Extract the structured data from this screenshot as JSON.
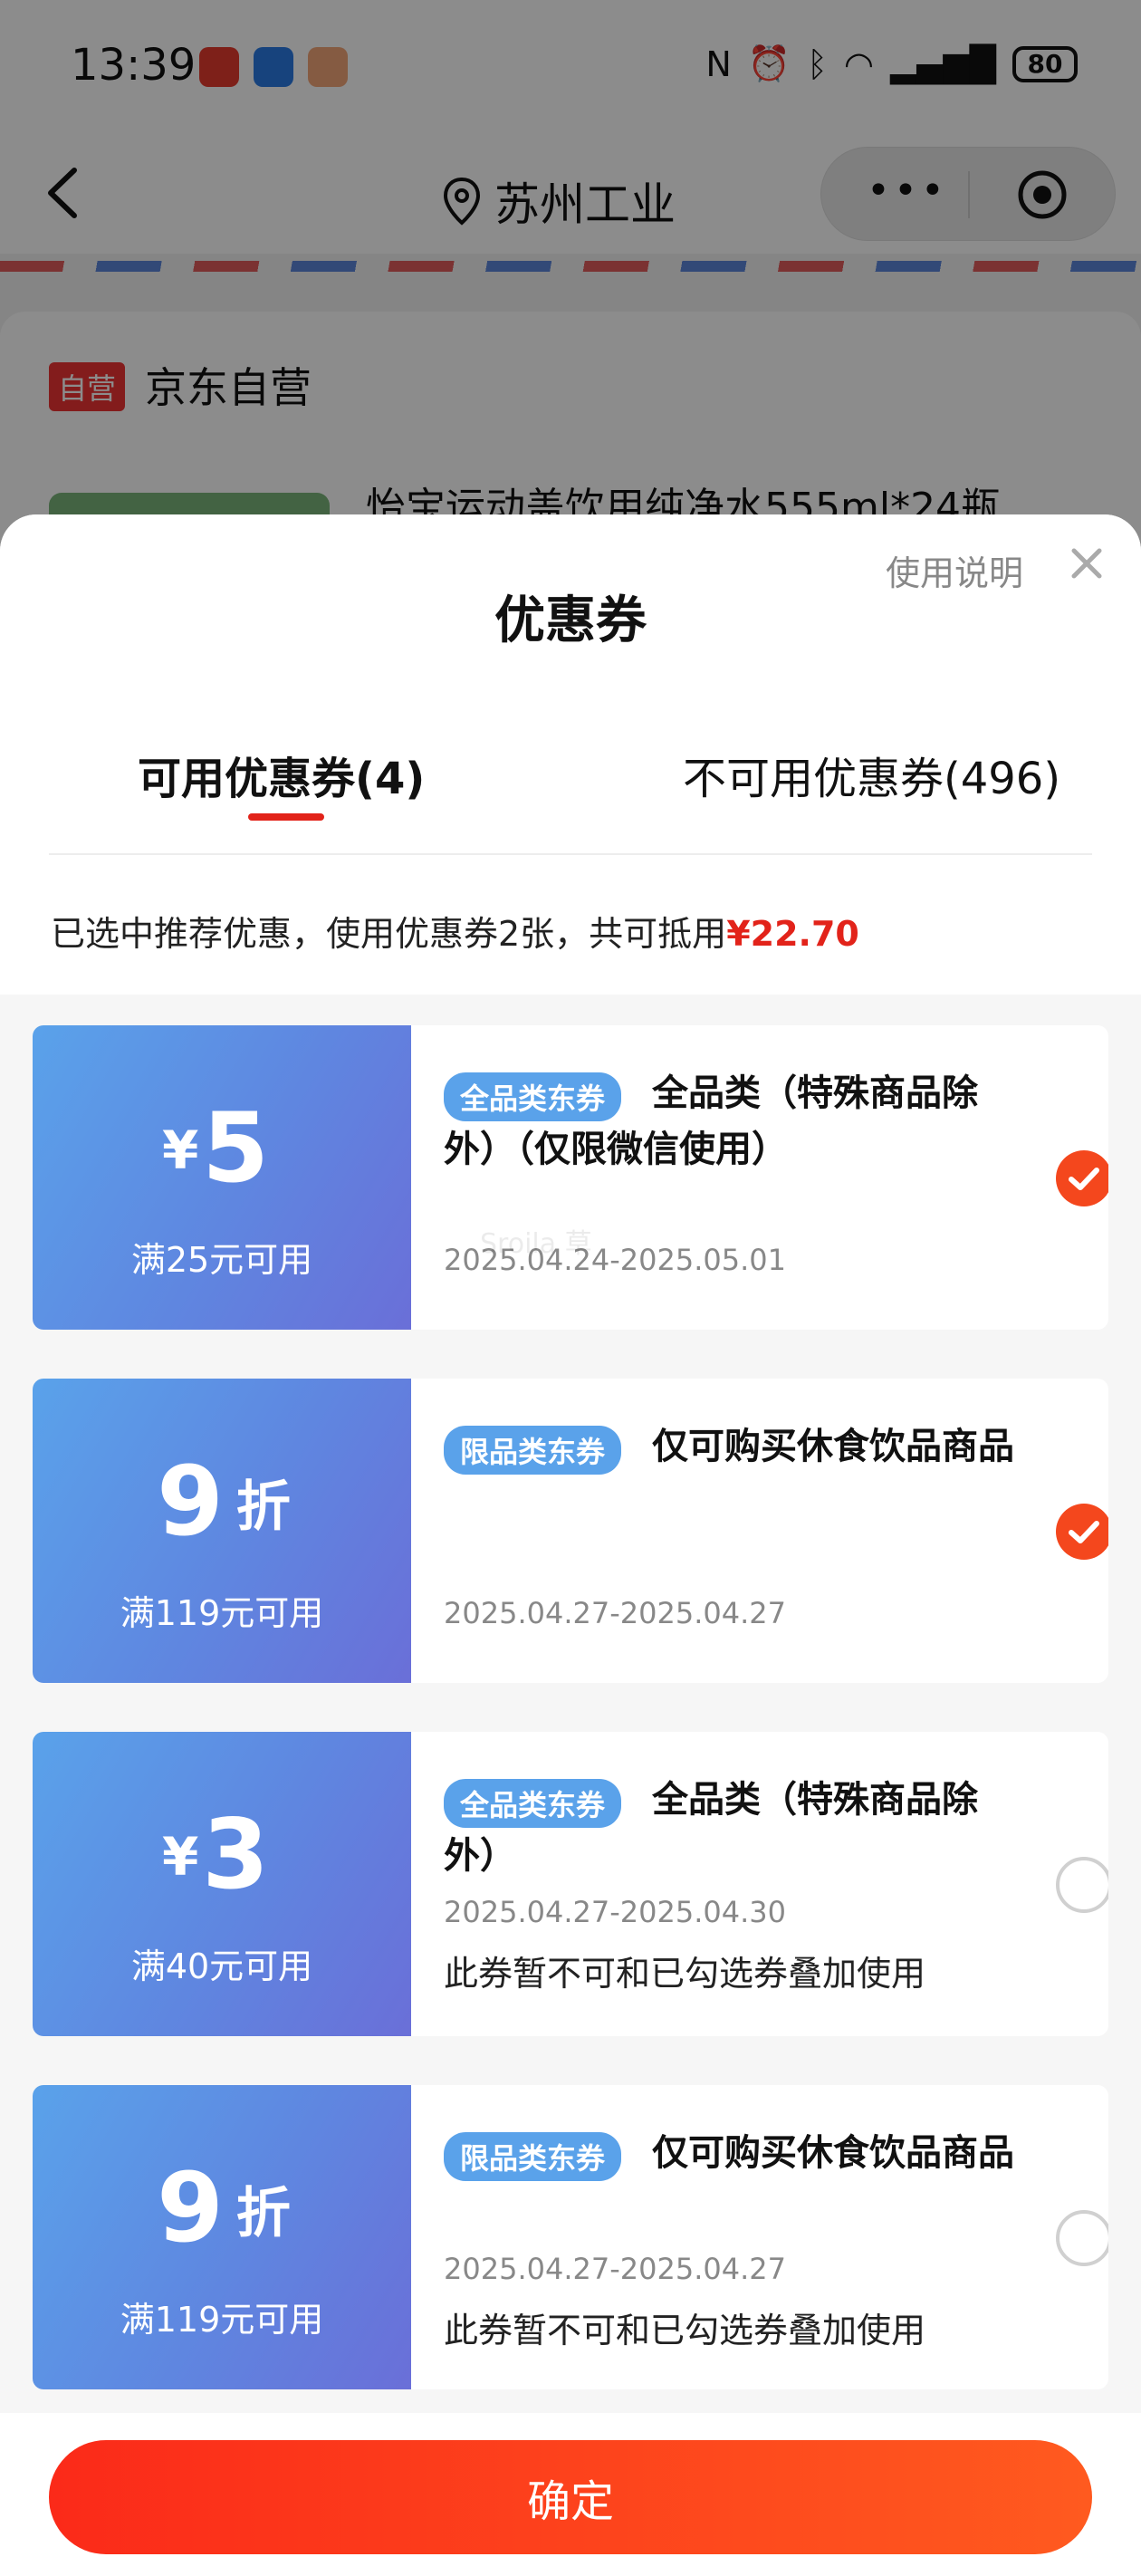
{
  "status_bar": {
    "time": "13:39",
    "battery": "80"
  },
  "nav": {
    "location": "苏州工业"
  },
  "store": {
    "tag": "自营",
    "name": "京东自营",
    "product_title": "怡宝运动盖饮用纯净水555ml*24瓶 ..."
  },
  "sheet": {
    "title": "优惠券",
    "help_label": "使用说明",
    "tabs": [
      {
        "label": "可用优惠券(4)",
        "active": true
      },
      {
        "label": "不可用优惠券(496)",
        "active": false
      }
    ],
    "summary_text": "已选中推荐优惠，使用优惠券2张，共可抵用",
    "summary_amount": "¥22.70",
    "watermark": "Sroila 草"
  },
  "coupons": [
    {
      "symbol": "¥",
      "value": "5",
      "unit": "",
      "condition": "满25元可用",
      "badge": "全品类东券",
      "title": "全品类（特殊商品除外）（仅限微信使用）",
      "date": "2025.04.24-2025.05.01",
      "note": "",
      "selected": true
    },
    {
      "symbol": "",
      "value": "9",
      "unit": "折",
      "condition": "满119元可用",
      "badge": "限品类东券",
      "title": "仅可购买休食饮品商品",
      "date": "2025.04.27-2025.04.27",
      "note": "",
      "selected": true
    },
    {
      "symbol": "¥",
      "value": "3",
      "unit": "",
      "condition": "满40元可用",
      "badge": "全品类东券",
      "title": "全品类（特殊商品除外）",
      "date": "2025.04.27-2025.04.30",
      "note": "此券暂不可和已勾选券叠加使用",
      "selected": false
    },
    {
      "symbol": "",
      "value": "9",
      "unit": "折",
      "condition": "满119元可用",
      "badge": "限品类东券",
      "title": "仅可购买休食饮品商品",
      "date": "2025.04.27-2025.04.27",
      "note": "此券暂不可和已勾选券叠加使用",
      "selected": false
    }
  ],
  "footer": {
    "confirm_label": "确定"
  },
  "colors": {
    "accent": "#e2231a",
    "button_start": "#fb2a19",
    "button_end": "#ff5a1f",
    "coupon_blue": "#5f86e0",
    "badge_blue": "#5aa2ea",
    "check_orange": "#f4471d"
  },
  "icons": {
    "back": "chevron-left-icon",
    "location": "location-pin-icon",
    "more": "more-dots-icon",
    "target": "target-icon",
    "close": "close-icon",
    "check": "check-icon"
  }
}
